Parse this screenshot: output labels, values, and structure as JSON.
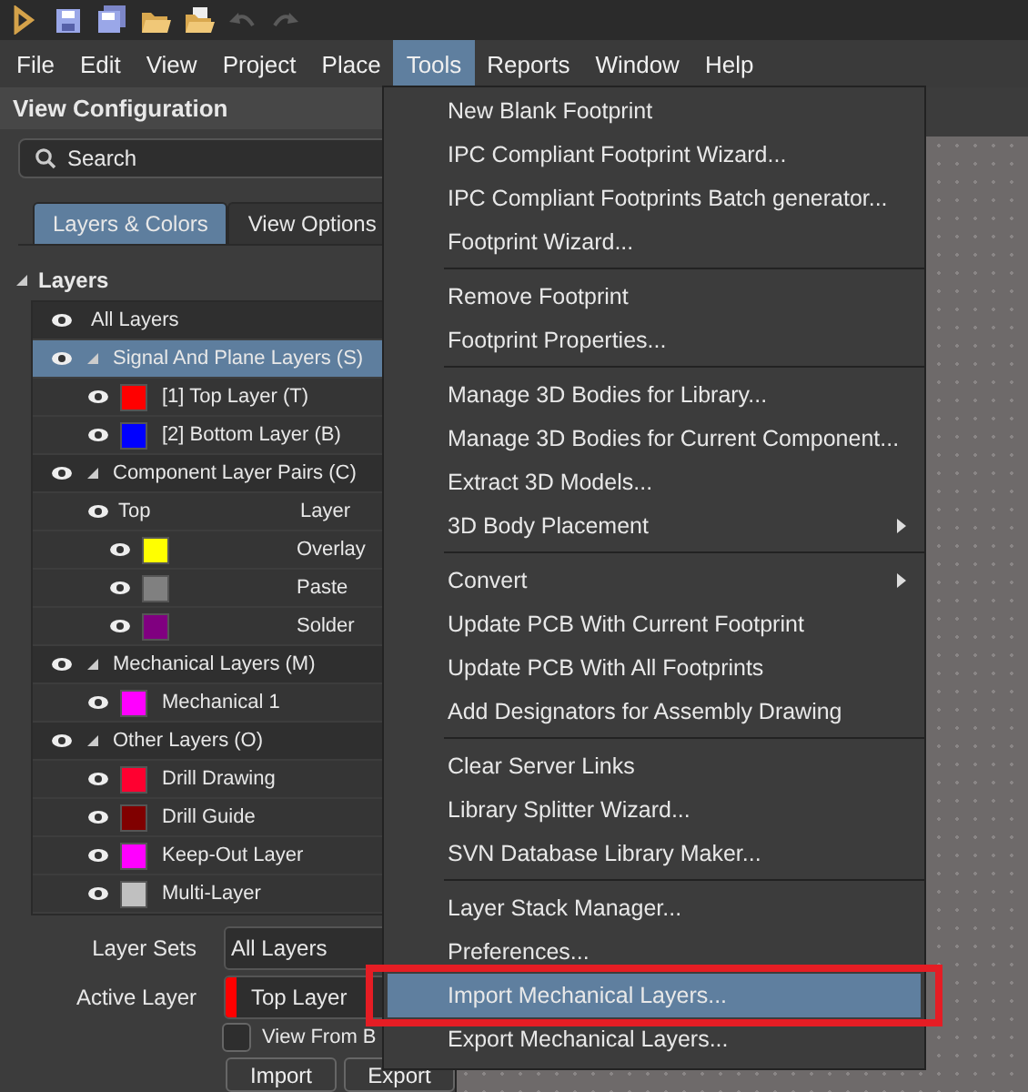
{
  "toolbar": {
    "buttons": [
      {
        "kind": "logo"
      },
      {
        "kind": "save"
      },
      {
        "kind": "save-all"
      },
      {
        "kind": "open"
      },
      {
        "kind": "open-project"
      },
      {
        "kind": "undo",
        "disabled": true
      },
      {
        "kind": "redo",
        "disabled": true
      }
    ]
  },
  "menubar": [
    {
      "label": "File",
      "selected": false
    },
    {
      "label": "Edit",
      "selected": false
    },
    {
      "label": "View",
      "selected": false
    },
    {
      "label": "Project",
      "selected": false
    },
    {
      "label": "Place",
      "selected": false
    },
    {
      "label": "Tools",
      "selected": true
    },
    {
      "label": "Reports",
      "selected": false
    },
    {
      "label": "Window",
      "selected": false
    },
    {
      "label": "Help",
      "selected": false
    }
  ],
  "panel": {
    "title": "View Configuration",
    "search": {
      "placeholder": "Search"
    },
    "tabs": [
      {
        "label": "Layers & Colors",
        "selected": true
      },
      {
        "label": "View Options",
        "selected": false
      }
    ],
    "section": {
      "label": "Layers",
      "expanded": true
    },
    "layers": [
      {
        "kind": "all",
        "label": "All Layers",
        "selected": false
      },
      {
        "kind": "group",
        "label": "Signal And Plane Layers (S)",
        "expanded": true,
        "selected": true,
        "children": [
          {
            "kind": "layer",
            "label": "[1] Top Layer (T)",
            "color": "#ff0000"
          },
          {
            "kind": "layer",
            "label": "[2] Bottom Layer (B)",
            "color": "#0000ff"
          }
        ]
      },
      {
        "kind": "group",
        "label": "Component Layer Pairs (C)",
        "expanded": true,
        "selected": false,
        "children": [
          {
            "kind": "pair",
            "label": "Top",
            "column_2": "Layer",
            "children": [
              {
                "kind": "layer",
                "label": "Overlay",
                "color": "#ffff00"
              },
              {
                "kind": "layer",
                "label": "Paste",
                "color": "#808080"
              },
              {
                "kind": "layer",
                "label": "Solder",
                "color": "#800080"
              }
            ]
          }
        ]
      },
      {
        "kind": "group",
        "label": "Mechanical Layers (M)",
        "expanded": true,
        "selected": false,
        "children": [
          {
            "kind": "layer",
            "label": "Mechanical 1",
            "color": "#ff00ff"
          }
        ]
      },
      {
        "kind": "group",
        "label": "Other Layers (O)",
        "expanded": true,
        "selected": false,
        "children": [
          {
            "kind": "layer",
            "label": "Drill Drawing",
            "color": "#ff0030"
          },
          {
            "kind": "layer",
            "label": "Drill Guide",
            "color": "#800000"
          },
          {
            "kind": "layer",
            "label": "Keep-Out Layer",
            "color": "#ff00ff"
          },
          {
            "kind": "layer",
            "label": "Multi-Layer",
            "color": "#c0c0c0"
          }
        ]
      }
    ],
    "layer_sets": {
      "label": "Layer Sets",
      "value": "All Layers"
    },
    "active_layer": {
      "label": "Active Layer",
      "value": "Top Layer",
      "color": "#ff0000"
    },
    "view_from_bottom": {
      "label": "View From B",
      "checked": false
    },
    "buttons": [
      "Import",
      "Export"
    ]
  },
  "tools_menu": [
    {
      "label": "New Blank Footprint",
      "selected": false
    },
    {
      "label": "IPC Compliant Footprint Wizard...",
      "selected": false
    },
    {
      "label": "IPC Compliant Footprints Batch generator...",
      "selected": false
    },
    {
      "label": "Footprint Wizard...",
      "selected": false
    },
    {
      "kind": "separator"
    },
    {
      "label": "Remove Footprint",
      "selected": false
    },
    {
      "label": "Footprint Properties...",
      "selected": false
    },
    {
      "kind": "separator"
    },
    {
      "label": "Manage 3D Bodies for Library...",
      "selected": false
    },
    {
      "label": "Manage 3D Bodies for Current Component...",
      "selected": false
    },
    {
      "label": "Extract 3D Models...",
      "selected": false
    },
    {
      "label": "3D Body Placement",
      "selected": false,
      "submenu": true
    },
    {
      "kind": "separator"
    },
    {
      "label": "Convert",
      "selected": false,
      "submenu": true
    },
    {
      "label": "Update PCB With Current Footprint",
      "selected": false
    },
    {
      "label": "Update PCB With All Footprints",
      "selected": false
    },
    {
      "label": "Add Designators for Assembly Drawing",
      "selected": false
    },
    {
      "kind": "separator"
    },
    {
      "label": "Clear Server Links",
      "selected": false
    },
    {
      "label": "Library Splitter Wizard...",
      "selected": false
    },
    {
      "label": "SVN Database Library Maker...",
      "selected": false
    },
    {
      "kind": "separator"
    },
    {
      "label": "Layer Stack Manager...",
      "selected": false
    },
    {
      "label": "Preferences...",
      "selected": false
    },
    {
      "label": "Import Mechanical Layers...",
      "selected": true,
      "outlined": true
    },
    {
      "label": "Export Mechanical Layers...",
      "selected": false
    }
  ]
}
